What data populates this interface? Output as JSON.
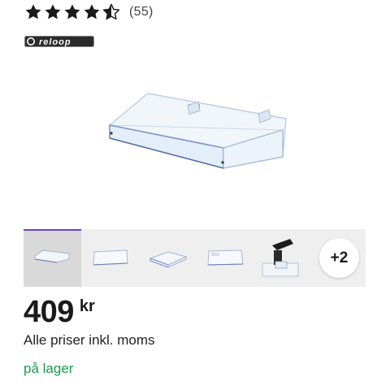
{
  "rating": {
    "value": 4.5,
    "max": 5,
    "count_label": "(55)"
  },
  "brand": {
    "logo_name": "reloop-logo",
    "text": "reloop"
  },
  "gallery": {
    "thumbnails": [
      {
        "name": "dust-cover-front"
      },
      {
        "name": "dust-cover-side"
      },
      {
        "name": "dust-cover-angle"
      },
      {
        "name": "dust-cover-low"
      },
      {
        "name": "hinge-detail"
      }
    ],
    "more_label": "+2"
  },
  "price": {
    "amount": "409",
    "currency": "kr"
  },
  "vat_note": "Alle priser inkl. moms",
  "stock_status": "på lager",
  "colors": {
    "accent": "#6b3fd4",
    "in_stock": "#1d9b4e",
    "star": "#1a1a1a"
  }
}
